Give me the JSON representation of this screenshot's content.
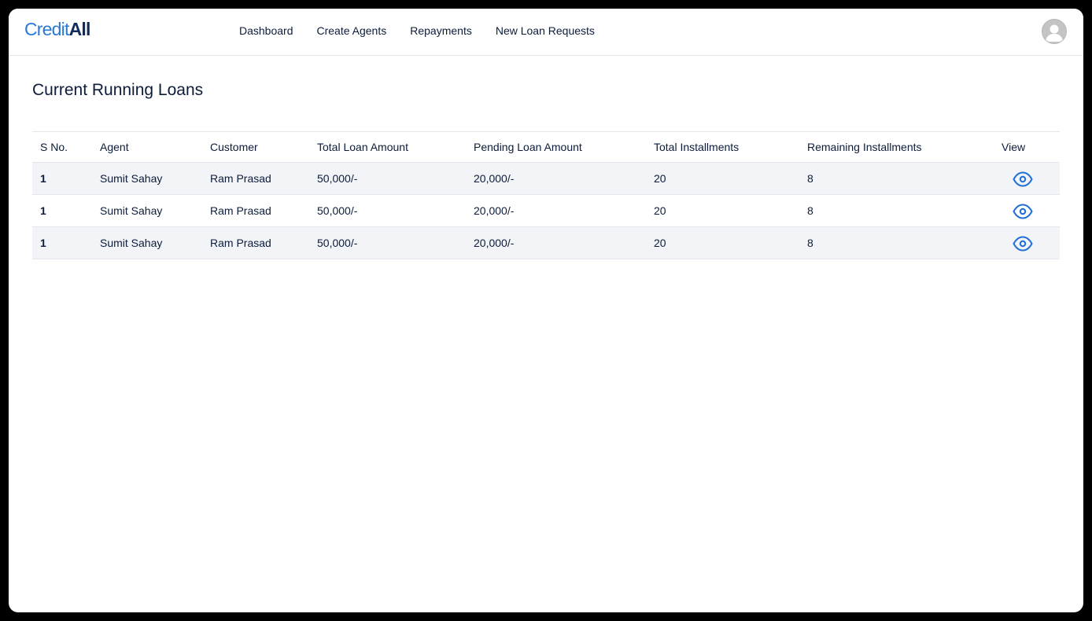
{
  "app": {
    "logo_part1": "Credit",
    "logo_part2": "All",
    "brand_color": "#2b78d6",
    "brand_dark": "#0f2c5c"
  },
  "nav": {
    "items": [
      {
        "label": "Dashboard"
      },
      {
        "label": "Create Agents"
      },
      {
        "label": "Repayments"
      },
      {
        "label": "New Loan Requests"
      }
    ]
  },
  "page": {
    "title": "Current Running Loans"
  },
  "table": {
    "headers": {
      "sno": "S No.",
      "agent": "Agent",
      "customer": "Customer",
      "total_loan": "Total Loan Amount",
      "pending_loan": "Pending Loan Amount",
      "total_installments": "Total Installments",
      "remaining_installments": "Remaining Installments",
      "view": "View"
    },
    "rows": [
      {
        "sno": "1",
        "agent": "Sumit Sahay",
        "customer": "Ram Prasad",
        "total_loan": "50,000/-",
        "pending_loan": "20,000/-",
        "total_installments": "20",
        "remaining_installments": "8",
        "view_icon": "eye-icon"
      },
      {
        "sno": "1",
        "agent": "Sumit Sahay",
        "customer": "Ram Prasad",
        "total_loan": "50,000/-",
        "pending_loan": "20,000/-",
        "total_installments": "20",
        "remaining_installments": "8",
        "view_icon": "eye-icon"
      },
      {
        "sno": "1",
        "agent": "Sumit Sahay",
        "customer": "Ram Prasad",
        "total_loan": "50,000/-",
        "pending_loan": "20,000/-",
        "total_installments": "20",
        "remaining_installments": "8",
        "view_icon": "eye-icon"
      }
    ]
  },
  "icons": {
    "eye_color": "#1f6fd6",
    "avatar": "user-avatar-icon"
  }
}
